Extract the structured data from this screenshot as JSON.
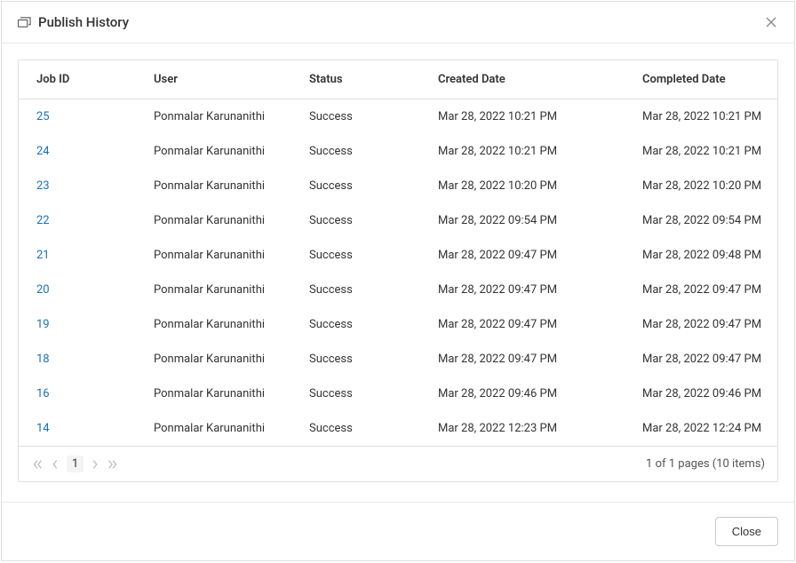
{
  "dialog": {
    "title": "Publish History",
    "close_button_label": "Close"
  },
  "table": {
    "columns": {
      "job_id": "Job ID",
      "user": "User",
      "status": "Status",
      "created": "Created Date",
      "completed": "Completed Date"
    },
    "rows": [
      {
        "job_id": "25",
        "user": "Ponmalar Karunanithi",
        "status": "Success",
        "created": "Mar 28, 2022 10:21 PM",
        "completed": "Mar 28, 2022 10:21 PM"
      },
      {
        "job_id": "24",
        "user": "Ponmalar Karunanithi",
        "status": "Success",
        "created": "Mar 28, 2022 10:21 PM",
        "completed": "Mar 28, 2022 10:21 PM"
      },
      {
        "job_id": "23",
        "user": "Ponmalar Karunanithi",
        "status": "Success",
        "created": "Mar 28, 2022 10:20 PM",
        "completed": "Mar 28, 2022 10:20 PM"
      },
      {
        "job_id": "22",
        "user": "Ponmalar Karunanithi",
        "status": "Success",
        "created": "Mar 28, 2022 09:54 PM",
        "completed": "Mar 28, 2022 09:54 PM"
      },
      {
        "job_id": "21",
        "user": "Ponmalar Karunanithi",
        "status": "Success",
        "created": "Mar 28, 2022 09:47 PM",
        "completed": "Mar 28, 2022 09:48 PM"
      },
      {
        "job_id": "20",
        "user": "Ponmalar Karunanithi",
        "status": "Success",
        "created": "Mar 28, 2022 09:47 PM",
        "completed": "Mar 28, 2022 09:47 PM"
      },
      {
        "job_id": "19",
        "user": "Ponmalar Karunanithi",
        "status": "Success",
        "created": "Mar 28, 2022 09:47 PM",
        "completed": "Mar 28, 2022 09:47 PM"
      },
      {
        "job_id": "18",
        "user": "Ponmalar Karunanithi",
        "status": "Success",
        "created": "Mar 28, 2022 09:47 PM",
        "completed": "Mar 28, 2022 09:47 PM"
      },
      {
        "job_id": "16",
        "user": "Ponmalar Karunanithi",
        "status": "Success",
        "created": "Mar 28, 2022 09:46 PM",
        "completed": "Mar 28, 2022 09:46 PM"
      },
      {
        "job_id": "14",
        "user": "Ponmalar Karunanithi",
        "status": "Success",
        "created": "Mar 28, 2022 12:23 PM",
        "completed": "Mar 28, 2022 12:24 PM"
      }
    ]
  },
  "pagination": {
    "current_page": "1",
    "summary": "1 of 1 pages (10 items)"
  }
}
